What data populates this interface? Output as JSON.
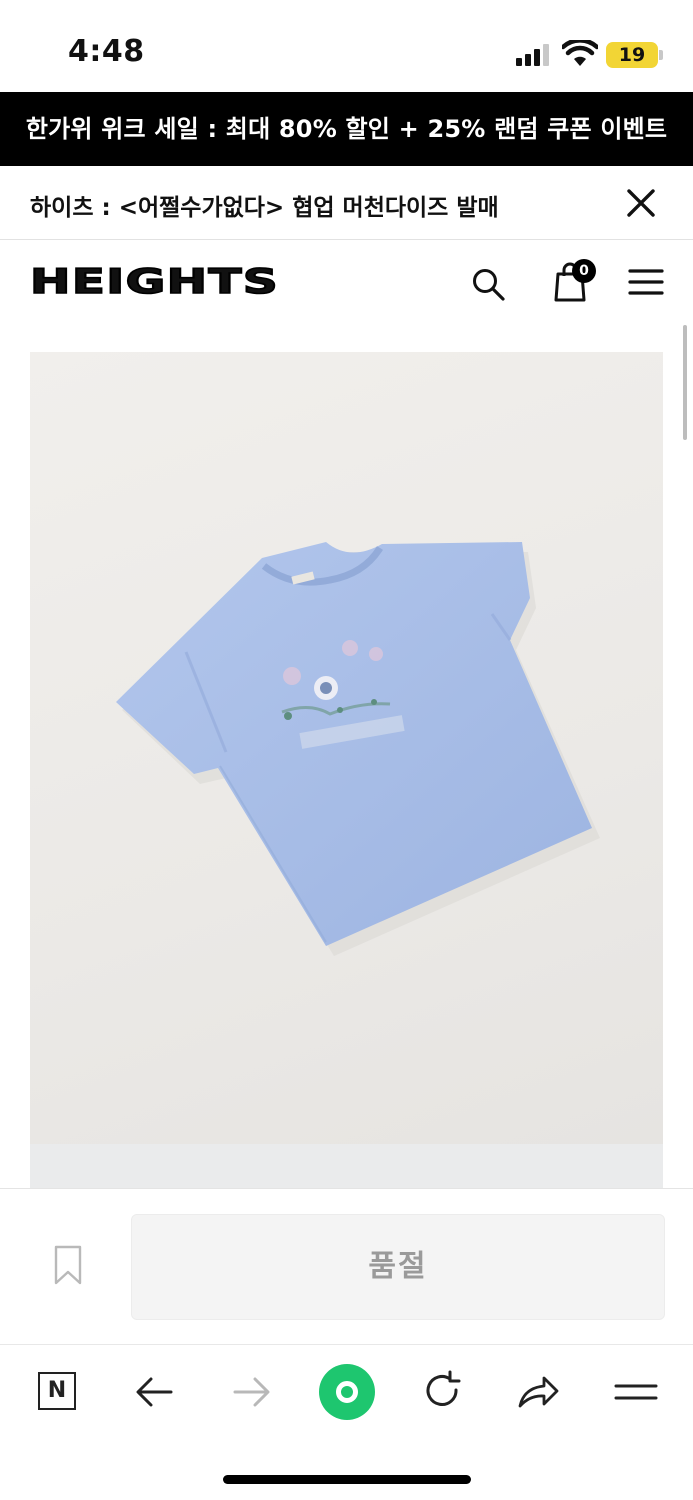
{
  "status_bar": {
    "time": "4:48",
    "battery": "19"
  },
  "sale_banner": {
    "text": "한가위 위크 세일 : 최대 80% 할인 + 25% 랜덤 쿠폰 이벤트"
  },
  "notice": {
    "text": "하이츠 : <어쩔수가없다> 협업 머천다이즈 발매"
  },
  "header": {
    "logo": "HEIGHTS",
    "cart_count": "0"
  },
  "product": {
    "image": "light-blue-tshirt-photo",
    "shirt_color": "#a6bde6"
  },
  "purchase_bar": {
    "button_label": "품절"
  },
  "browser_toolbar": {
    "n_label": "N",
    "accent_color": "#1ec66f"
  }
}
